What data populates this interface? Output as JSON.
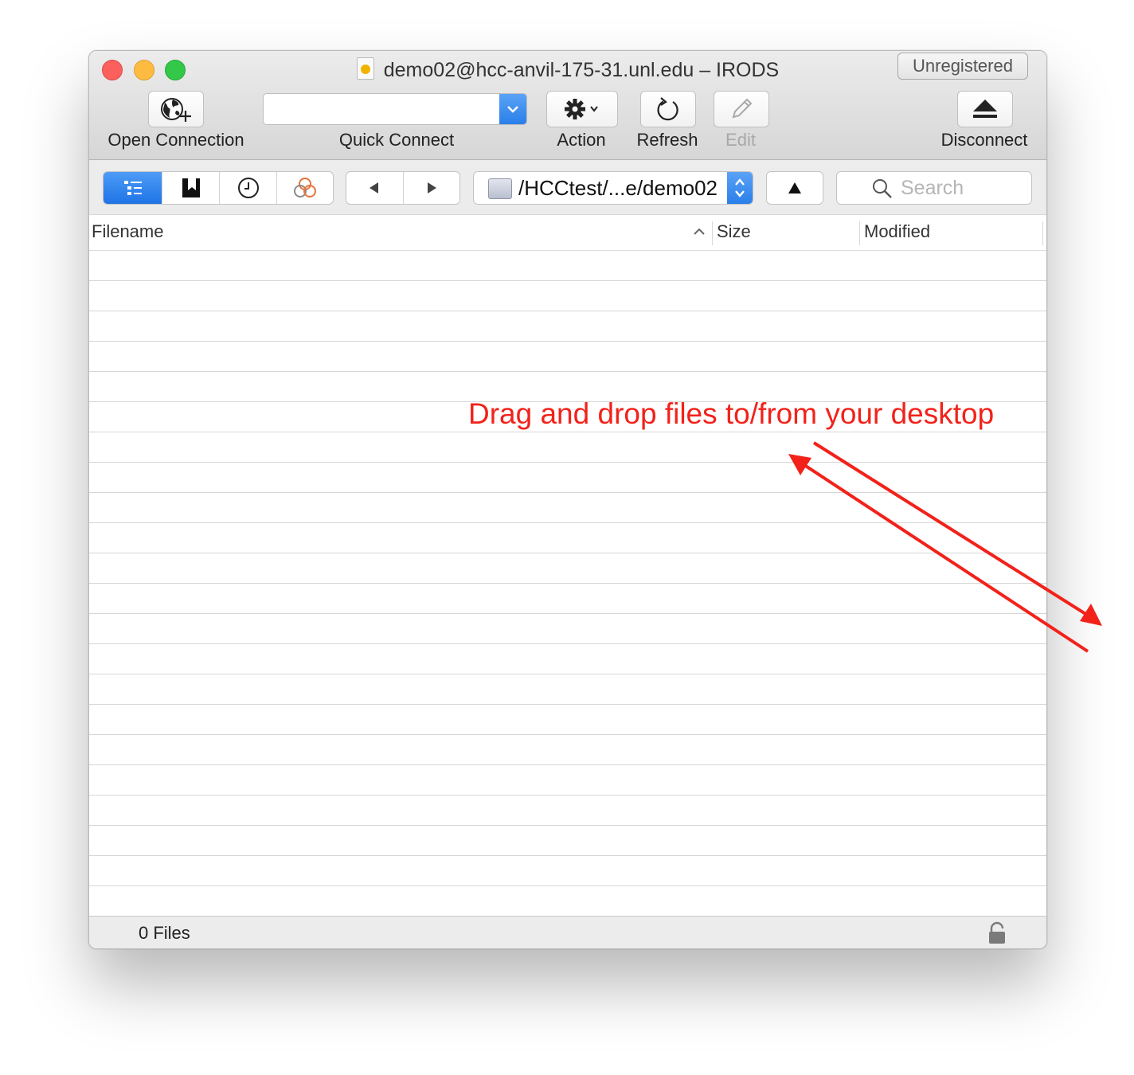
{
  "window": {
    "title": "demo02@hcc-anvil-175-31.unl.edu – IRODS",
    "badge": "Unregistered"
  },
  "toolbar": {
    "open_connection": "Open Connection",
    "quick_connect": "Quick Connect",
    "quick_connect_value": "",
    "action": "Action",
    "refresh": "Refresh",
    "edit": "Edit",
    "disconnect": "Disconnect"
  },
  "navbar": {
    "views": [
      "browser-icon",
      "bookmarks-icon",
      "history-icon",
      "bonjour-icon"
    ],
    "active_view": "browser-icon",
    "path": "/HCCtest/...e/demo02",
    "up_icon": "up-triangle-icon",
    "search_placeholder": "Search"
  },
  "table": {
    "columns": [
      "Filename",
      "Size",
      "Modified"
    ],
    "sort_column": "Filename",
    "rows": []
  },
  "status": {
    "file_count": "0 Files",
    "lock_icon": "lock-icon"
  },
  "annotation": {
    "text": "Drag and drop files to/from your desktop",
    "color": "#f2221a"
  },
  "colors": {
    "accent_blue": "#2a7fe9",
    "close": "#fc605c",
    "minimize": "#fdbc40",
    "maximize": "#34c84a"
  }
}
